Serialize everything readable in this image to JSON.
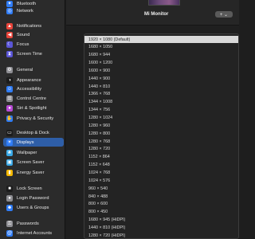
{
  "sidebar": {
    "items": [
      {
        "label": "Bluetooth",
        "icon": "bluetooth-icon",
        "glyph": "✦",
        "color": "#2f7cf6",
        "active": false
      },
      {
        "label": "Network",
        "icon": "network-icon",
        "glyph": "◎",
        "color": "#2f7cf6",
        "active": false
      },
      {
        "label": "Notifications",
        "icon": "bell-icon",
        "glyph": "▲",
        "color": "#e8443a",
        "active": false
      },
      {
        "label": "Sound",
        "icon": "speaker-icon",
        "glyph": "◀",
        "color": "#e8443a",
        "active": false
      },
      {
        "label": "Focus",
        "icon": "moon-icon",
        "glyph": "☾",
        "color": "#5a55d6",
        "active": false
      },
      {
        "label": "Screen Time",
        "icon": "hourglass-icon",
        "glyph": "⧗",
        "color": "#5a55d6",
        "active": false
      },
      {
        "label": "General",
        "icon": "gear-icon",
        "glyph": "⚙",
        "color": "#8e8e93",
        "active": false
      },
      {
        "label": "Appearance",
        "icon": "appearance-icon",
        "glyph": "◑",
        "color": "#1c1c1c",
        "active": false
      },
      {
        "label": "Accessibility",
        "icon": "accessibility-icon",
        "glyph": "☺",
        "color": "#2f7cf6",
        "active": false
      },
      {
        "label": "Control Centre",
        "icon": "control-centre-icon",
        "glyph": "☰",
        "color": "#8e8e93",
        "active": false
      },
      {
        "label": "Siri & Spotlight",
        "icon": "siri-icon",
        "glyph": "●",
        "color": "#b84ad6",
        "active": false
      },
      {
        "label": "Privacy & Security",
        "icon": "hand-icon",
        "glyph": "✋",
        "color": "#2f7cf6",
        "active": false
      },
      {
        "label": "Desktop & Dock",
        "icon": "dock-icon",
        "glyph": "▭",
        "color": "#1c1c1c",
        "active": false
      },
      {
        "label": "Displays",
        "icon": "display-icon",
        "glyph": "☀",
        "color": "#2f7cf6",
        "active": true
      },
      {
        "label": "Wallpaper",
        "icon": "wallpaper-icon",
        "glyph": "❀",
        "color": "#38a9e8",
        "active": false
      },
      {
        "label": "Screen Saver",
        "icon": "screen-saver-icon",
        "glyph": "▣",
        "color": "#38a9e8",
        "active": false
      },
      {
        "label": "Energy Saver",
        "icon": "battery-icon",
        "glyph": "▮",
        "color": "#f5b800",
        "active": false
      },
      {
        "label": "Lock Screen",
        "icon": "lock-screen-icon",
        "glyph": "■",
        "color": "#1c1c1c",
        "active": false
      },
      {
        "label": "Login Password",
        "icon": "lock-icon",
        "glyph": "●",
        "color": "#8e8e93",
        "active": false
      },
      {
        "label": "Users & Groups",
        "icon": "users-icon",
        "glyph": "☻",
        "color": "#2f7cf6",
        "active": false
      },
      {
        "label": "Passwords",
        "icon": "key-icon",
        "glyph": "⚿",
        "color": "#8e8e93",
        "active": false
      },
      {
        "label": "Internet Accounts",
        "icon": "at-icon",
        "glyph": "@",
        "color": "#2f7cf6",
        "active": false
      }
    ]
  },
  "header": {
    "monitor_name": "Mi Monitor",
    "add_button": "+ ⌄"
  },
  "resolutions": {
    "selected_index": 0,
    "options": [
      "1920 × 1080 (Default)",
      "1680 × 1050",
      "1680 × 944",
      "1600 × 1200",
      "1600 × 900",
      "1440 × 900",
      "1440 × 810",
      "1366 × 768",
      "1344 × 1008",
      "1344 × 756",
      "1280 × 1024",
      "1280 × 960",
      "1280 × 800",
      "1280 × 768",
      "1280 × 720",
      "1152 × 864",
      "1152 × 648",
      "1024 × 768",
      "1024 × 576",
      "960 × 540",
      "840 × 488",
      "800 × 600",
      "800 × 450",
      "1680 × 945 (HiDPI)",
      "1440 × 810 (HiDPI)",
      "1280 × 720 (HiDPI)"
    ]
  }
}
